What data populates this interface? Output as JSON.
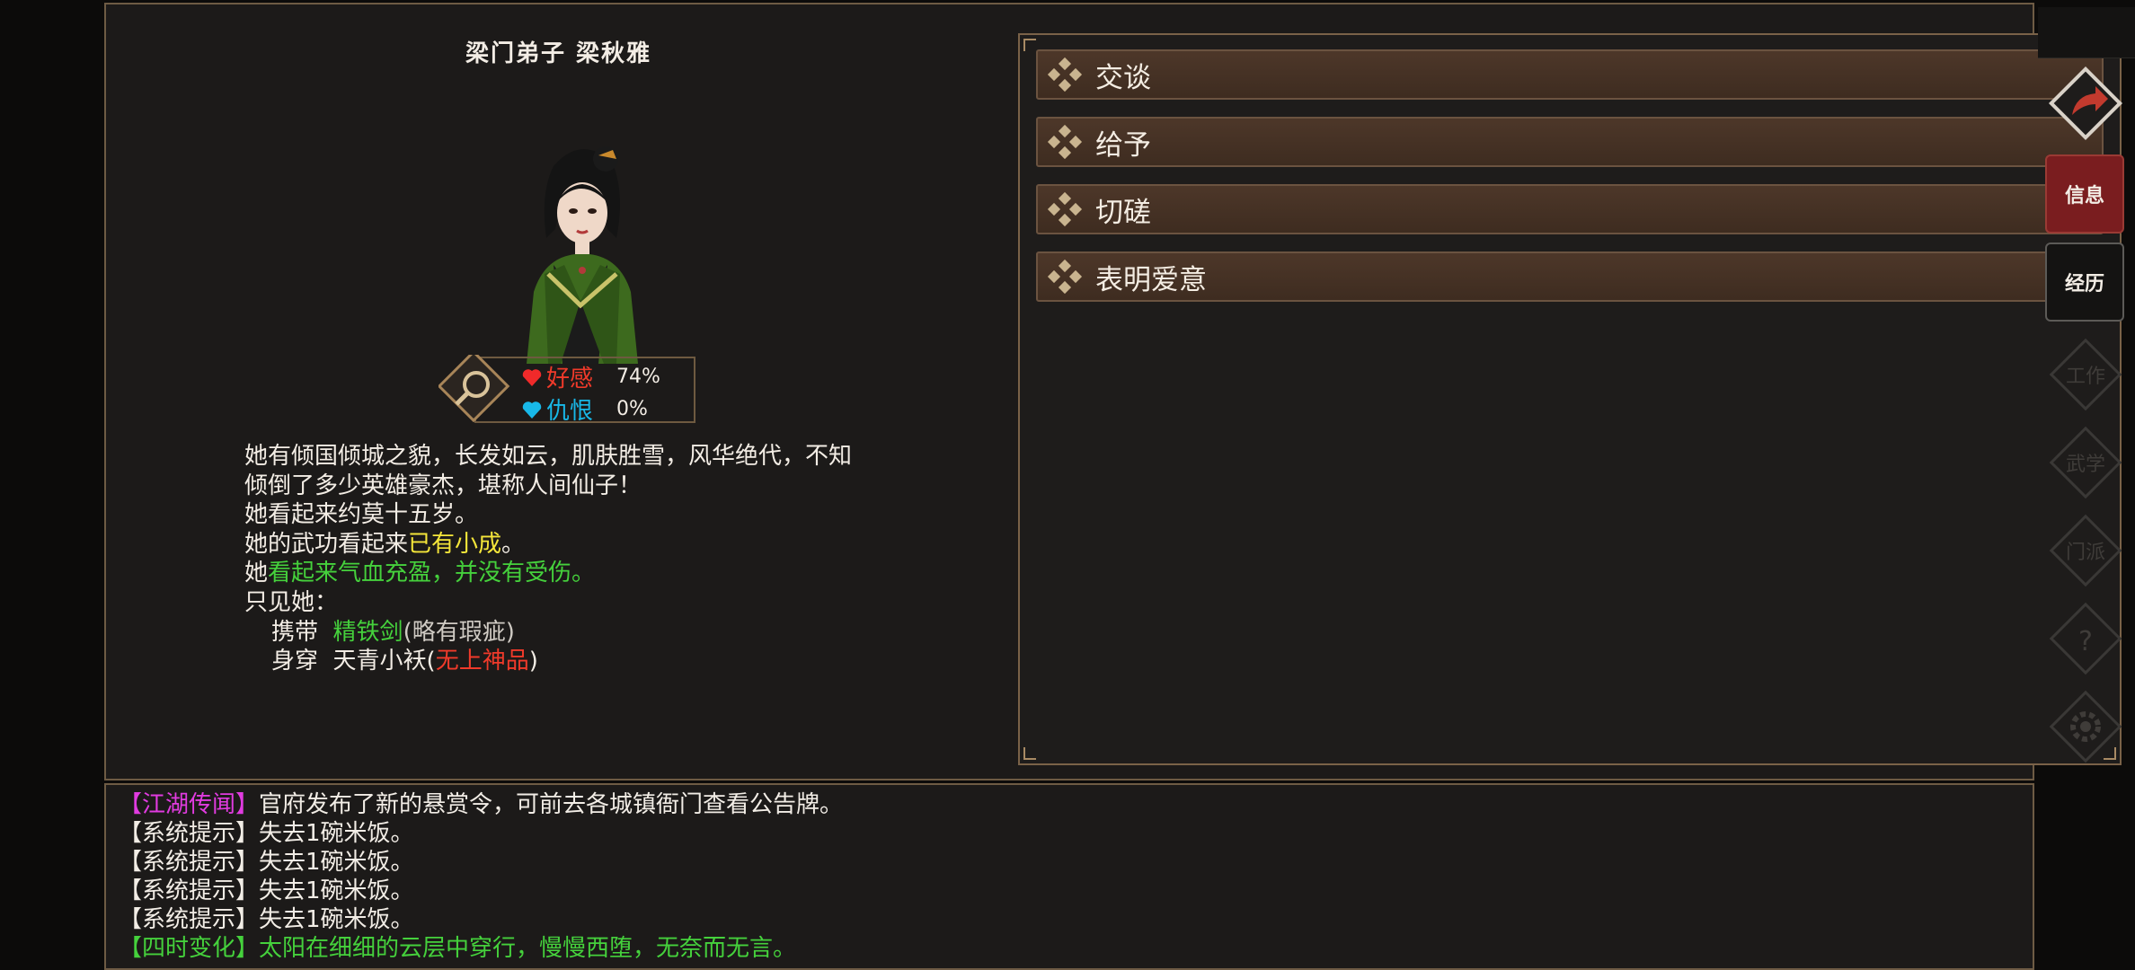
{
  "npc": {
    "title": "梁门弟子  梁秋雅",
    "affection_label": "好感",
    "affection_value": "74%",
    "hatred_label": "仇恨",
    "hatred_value": "0%"
  },
  "description": {
    "line1": "她有倾国倾城之貌，长发如云，肌肤胜雪，风华绝代，不知",
    "line2": "倾倒了多少英雄豪杰，堪称人间仙子！",
    "line3": "她看起来约莫十五岁。",
    "line4_prefix": "她的武功看起来",
    "line4_highlight": "已有小成",
    "line4_suffix": "。",
    "line5_prefix": "她",
    "line5_highlight": "看起来气血充盈，并没有受伤。",
    "line6": "只见她：",
    "carry_label": "携带",
    "carry_item": "精铁剑",
    "carry_condition": "(略有瑕疵)",
    "wear_label": "身穿",
    "wear_item": "天青小袄(",
    "wear_quality": "无上神品",
    "wear_close": ")"
  },
  "actions": [
    "交谈",
    "给予",
    "切磋",
    "表明爱意"
  ],
  "log": [
    {
      "tag": "【江湖传闻】",
      "text": "官府发布了新的悬赏令，可前去各城镇衙门查看公告牌。"
    },
    {
      "tag": "【系统提示】",
      "text": "失去1碗米饭。"
    },
    {
      "tag": "【系统提示】",
      "text": "失去1碗米饭。"
    },
    {
      "tag": "【系统提示】",
      "text": "失去1碗米饭。"
    },
    {
      "tag": "【系统提示】",
      "text": "失去1碗米饭。"
    },
    {
      "tag": "【四时变化】",
      "text": "太阳在细细的云层中穿行，慢慢西堕，无奈而无言。"
    }
  ],
  "nav": {
    "info": "信息",
    "history": "经历",
    "work": "工作",
    "martial": "武学",
    "sect": "门派",
    "help": "?",
    "settings_icon": "gear-icon",
    "back_icon": "back-arrow-icon"
  },
  "colors": {
    "accent_red": "#7a1d1f",
    "button_brown": "#4d3729",
    "highlight_yellow": "#f5e63a",
    "highlight_green": "#45d13c",
    "highlight_red": "#f03a2a",
    "tag_magenta": "#e13be0"
  }
}
